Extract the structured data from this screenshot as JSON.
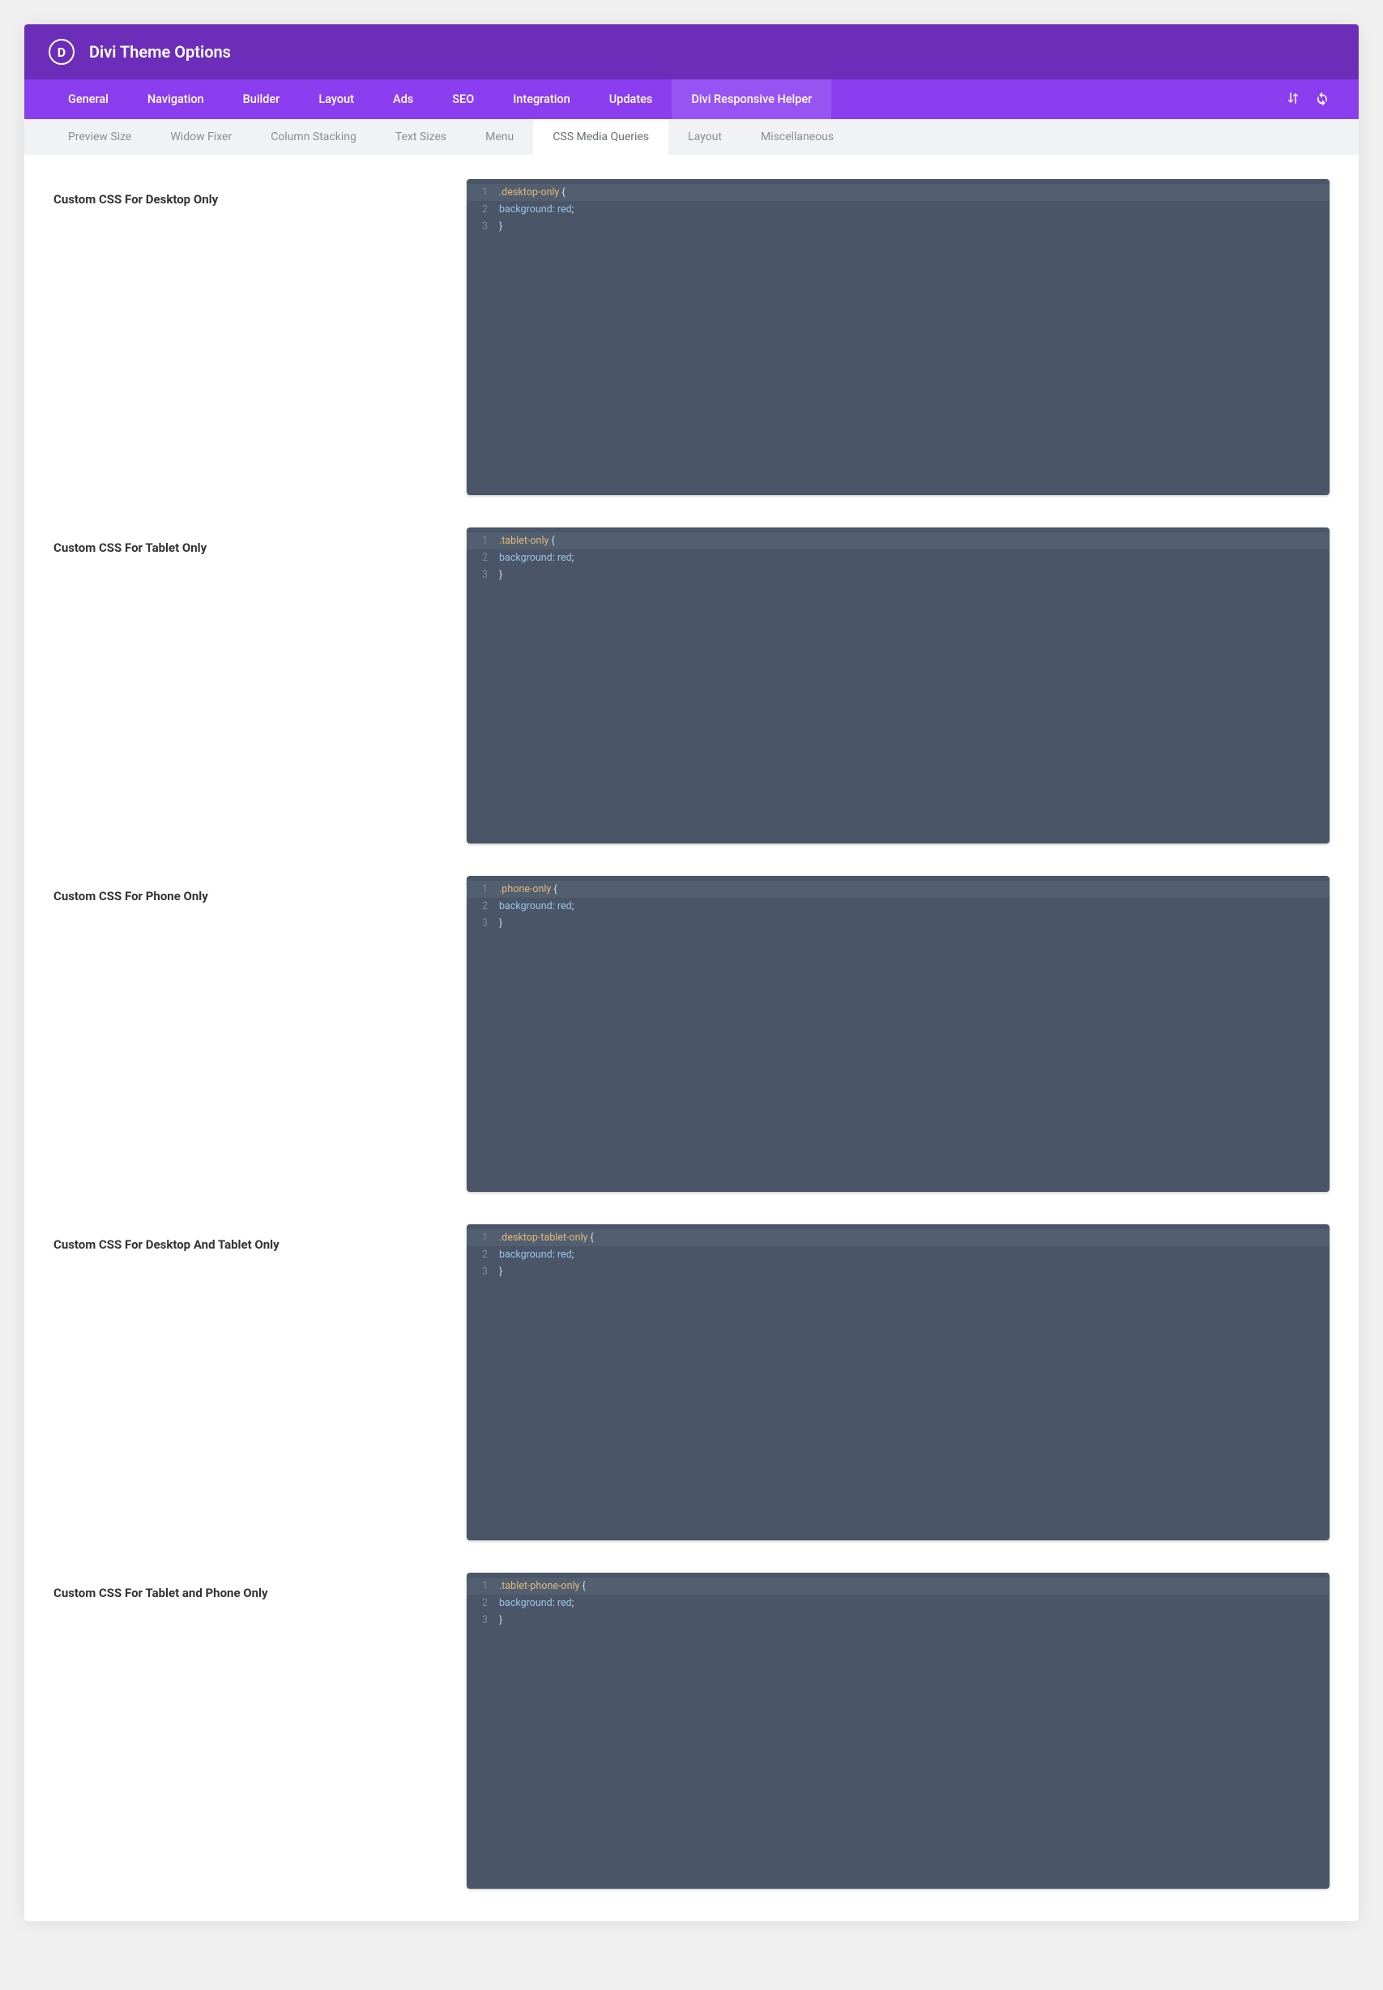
{
  "header": {
    "logo_letter": "D",
    "title": "Divi Theme Options"
  },
  "primary_tabs": [
    {
      "id": "general",
      "label": "General",
      "active": false
    },
    {
      "id": "navigation",
      "label": "Navigation",
      "active": false
    },
    {
      "id": "builder",
      "label": "Builder",
      "active": false
    },
    {
      "id": "layout",
      "label": "Layout",
      "active": false
    },
    {
      "id": "ads",
      "label": "Ads",
      "active": false
    },
    {
      "id": "seo",
      "label": "SEO",
      "active": false
    },
    {
      "id": "integration",
      "label": "Integration",
      "active": false
    },
    {
      "id": "updates",
      "label": "Updates",
      "active": false
    },
    {
      "id": "responsive-helper",
      "label": "Divi Responsive Helper",
      "active": true
    }
  ],
  "secondary_tabs": [
    {
      "id": "preview-size",
      "label": "Preview Size",
      "active": false
    },
    {
      "id": "widow-fixer",
      "label": "Widow Fixer",
      "active": false
    },
    {
      "id": "column-stacking",
      "label": "Column Stacking",
      "active": false
    },
    {
      "id": "text-sizes",
      "label": "Text Sizes",
      "active": false
    },
    {
      "id": "menu",
      "label": "Menu",
      "active": false
    },
    {
      "id": "css-media-queries",
      "label": "CSS Media Queries",
      "active": true
    },
    {
      "id": "layout2",
      "label": "Layout",
      "active": false
    },
    {
      "id": "misc",
      "label": "Miscellaneous",
      "active": false
    }
  ],
  "css_sections": [
    {
      "id": "desktop-only",
      "label": "Custom CSS For Desktop Only",
      "selector": ".desktop-only",
      "property": "background",
      "value": "red"
    },
    {
      "id": "tablet-only",
      "label": "Custom CSS For Tablet Only",
      "selector": ".tablet-only",
      "property": "background",
      "value": "red"
    },
    {
      "id": "phone-only",
      "label": "Custom CSS For Phone Only",
      "selector": ".phone-only",
      "property": "background",
      "value": "red"
    },
    {
      "id": "desktop-tablet-only",
      "label": "Custom CSS For Desktop And Tablet Only",
      "selector": ".desktop-tablet-only",
      "property": "background",
      "value": "red"
    },
    {
      "id": "tablet-phone-only",
      "label": "Custom CSS For Tablet and Phone Only",
      "selector": ".tablet-phone-only",
      "property": "background",
      "value": "red"
    }
  ]
}
